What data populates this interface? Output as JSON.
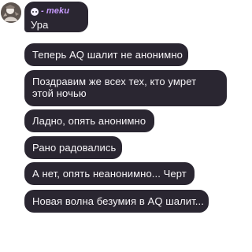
{
  "chat": {
    "sender": {
      "name": "- meku",
      "avatar_icon": "profile-avatar"
    },
    "messages": [
      {
        "text": "Ура"
      },
      {
        "text": "Теперь AQ шалит не анонимно"
      },
      {
        "text": "Поздравим же всех тех, кто умрет этой ночью"
      },
      {
        "text": "Ладно, опять анонимно"
      },
      {
        "text": "Рано радовались"
      },
      {
        "text": "А нет, опять неанонимно... Черт"
      },
      {
        "text": "Новая волна безумия в AQ шалит..."
      }
    ]
  }
}
